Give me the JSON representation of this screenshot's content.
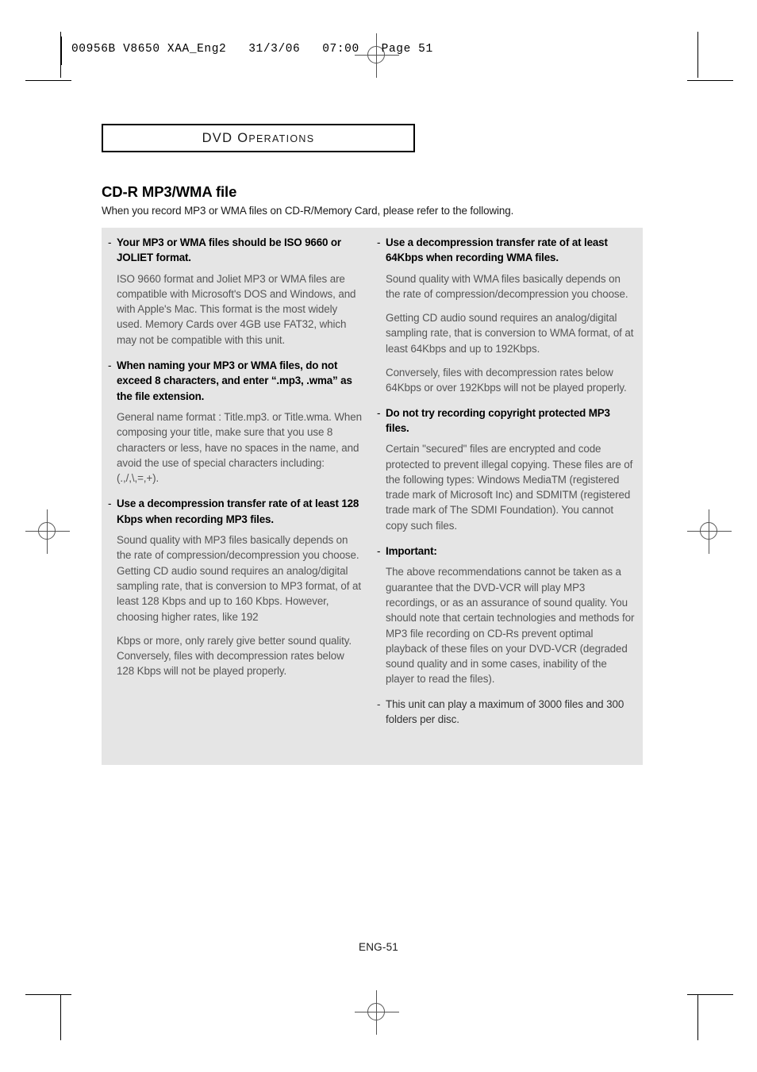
{
  "printer_header": {
    "text": "00956B V8650 XAA_Eng2   31/3/06   07:00   Page 51"
  },
  "section_box": {
    "title_lead": "DVD",
    "title_first_cap": "O",
    "title_rest": "PERATIONS"
  },
  "page": {
    "title": "CD-R MP3/WMA file",
    "intro": "When you record MP3 or WMA files on CD-R/Memory Card, please refer to the following.",
    "footer": "ENG-51"
  },
  "left_column": {
    "blocks": [
      {
        "dash": "-",
        "heading": "Your MP3 or WMA files should be ISO 9660 or JOLIET format.",
        "paragraphs": [
          "ISO 9660 format and Joliet MP3 or WMA files are compatible with Microsoft's DOS and Windows, and with Apple's Mac. This format is the most widely used. Memory Cards over 4GB use FAT32, which may not be compatible with this unit."
        ]
      },
      {
        "dash": "-",
        "heading": "When naming your MP3 or WMA files, do not exceed 8 characters, and enter “.mp3, .wma” as the file extension.",
        "paragraphs": [
          "General name format : Title.mp3. or Title.wma. When composing your title, make sure that you use 8 characters or less, have no spaces in the name, and avoid the use of special characters including: (.,/,\\,=,+)."
        ]
      },
      {
        "dash": "-",
        "heading": "Use a decompression transfer rate of at least 128 Kbps when recording MP3 files.",
        "paragraphs": [
          "Sound quality with MP3 files basically depends on the rate of compression/decompression you choose. Getting CD audio sound requires an analog/digital sampling rate, that is conversion to MP3 format, of at least 128 Kbps and up to 160 Kbps. However, choosing higher rates, like 192",
          "Kbps or more, only rarely give better sound quality. Conversely, files with decompression rates below 128 Kbps will not be played properly."
        ]
      }
    ]
  },
  "right_column": {
    "blocks": [
      {
        "dash": "-",
        "heading": "Use a decompression transfer rate of at least 64Kbps when recording WMA files.",
        "paragraphs": [
          "Sound quality with WMA files basically depends on the rate of compression/decompression you choose.",
          "Getting CD audio sound requires an analog/digital sampling rate, that is conversion to WMA format, of at least 64Kbps and up to 192Kbps.",
          "Conversely, files with decompression rates below 64Kbps or over 192Kbps will not be played properly."
        ]
      },
      {
        "dash": "-",
        "heading": "Do not try recording copyright protected MP3 files.",
        "paragraphs": [
          "Certain \"secured\" files are encrypted and code protected to prevent illegal copying. These files are of the following types: Windows MediaTM (registered trade mark of Microsoft Inc) and SDMITM (registered trade mark of The SDMI Foundation). You cannot copy such files."
        ]
      },
      {
        "dash": "-",
        "heading": "Important:",
        "paragraphs": [
          "The above recommendations cannot be taken as a guarantee that the DVD-VCR will play MP3 recordings, or as an assurance of sound quality. You should note that certain technologies and methods for MP3 file recording on CD-Rs prevent optimal playback of these files on your DVD-VCR (degraded sound quality and in some cases, inability of the player to read the files)."
        ]
      }
    ],
    "final_note": {
      "dash": "-",
      "text": "This unit can play a maximum of 3000 files and 300 folders per disc."
    }
  }
}
